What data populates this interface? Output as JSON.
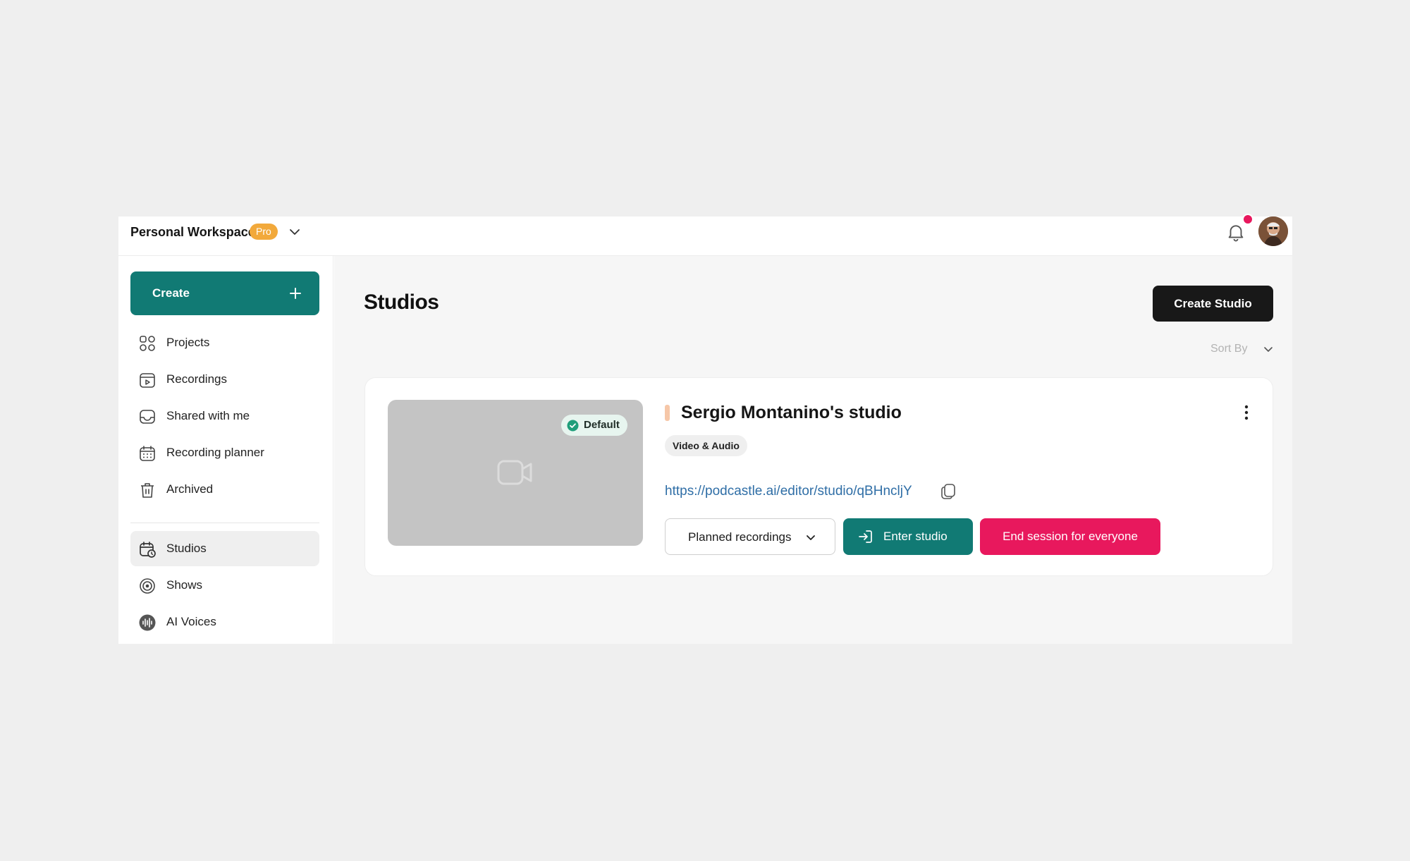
{
  "workspace": {
    "name": "Personal Workspace",
    "plan_badge": "Pro"
  },
  "header": {
    "notifications_icon": "bell-icon",
    "notification_dot_color": "#e8175d"
  },
  "sidebar": {
    "create_label": "Create",
    "items": [
      {
        "label": "Projects",
        "icon": "grid-icon"
      },
      {
        "label": "Recordings",
        "icon": "recording-icon"
      },
      {
        "label": "Shared with me",
        "icon": "inbox-icon"
      },
      {
        "label": "Recording planner",
        "icon": "calendar-icon"
      },
      {
        "label": "Archived",
        "icon": "trash-icon"
      },
      {
        "label": "Studios",
        "icon": "studio-calendar-icon",
        "active": true
      },
      {
        "label": "Shows",
        "icon": "podcast-icon"
      },
      {
        "label": "AI Voices",
        "icon": "waveform-icon"
      }
    ]
  },
  "main": {
    "title": "Studios",
    "create_studio_label": "Create Studio",
    "sort_label": "Sort By"
  },
  "studio_card": {
    "default_badge": "Default",
    "name": "Sergio Montanino's studio",
    "type": "Video & Audio",
    "link": "https://podcastle.ai/editor/studio/qBHncljY",
    "planned_label": "Planned recordings",
    "enter_label": "Enter studio",
    "end_label": "End session for everyone"
  },
  "colors": {
    "primary": "#117a74",
    "danger": "#e8185d",
    "pro_badge": "#f2a93b",
    "link": "#2f6ea6"
  }
}
